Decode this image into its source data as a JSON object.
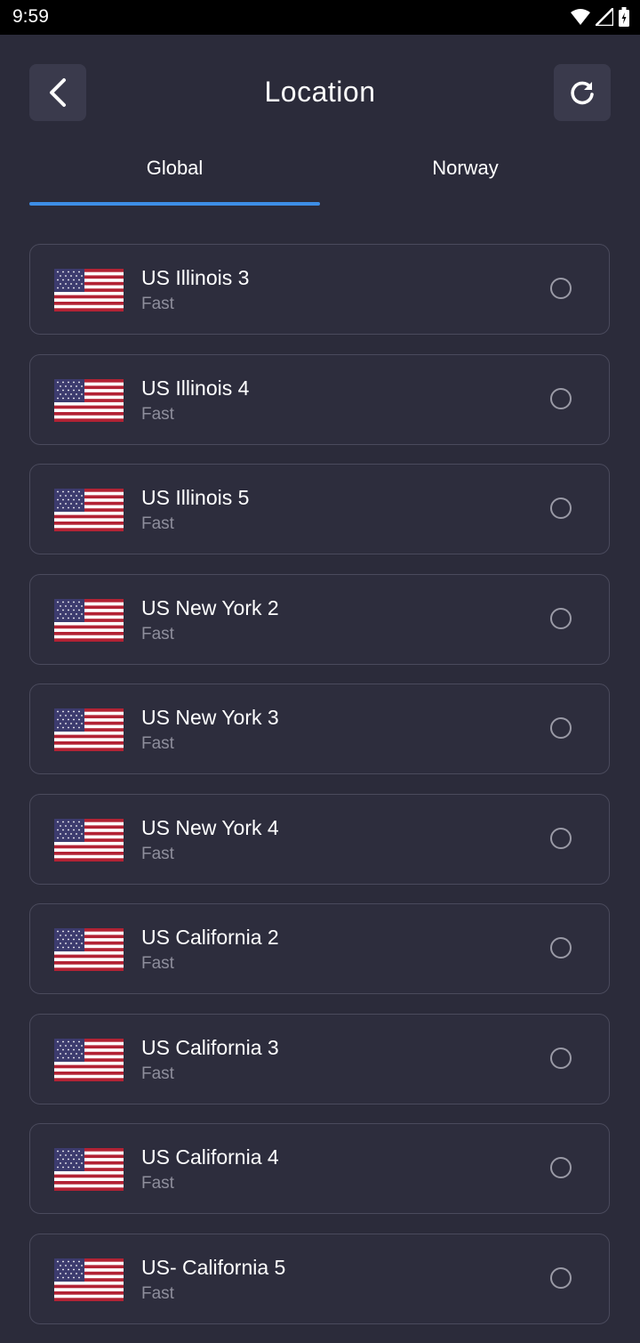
{
  "status_bar": {
    "time": "9:59"
  },
  "header": {
    "title": "Location"
  },
  "tabs": [
    {
      "label": "Global"
    },
    {
      "label": "Norway"
    }
  ],
  "colors": {
    "background": "#2b2b3a",
    "accent": "#3d8ee6",
    "card_border": "#4a4a5c",
    "subtext": "#8e8e9c"
  },
  "locations": [
    {
      "name": "US Illinois 3",
      "speed": "Fast",
      "flag": "us-flag-icon"
    },
    {
      "name": "US Illinois 4",
      "speed": "Fast",
      "flag": "us-flag-icon"
    },
    {
      "name": "US Illinois 5",
      "speed": "Fast",
      "flag": "us-flag-icon"
    },
    {
      "name": "US New York 2",
      "speed": "Fast",
      "flag": "us-flag-icon"
    },
    {
      "name": "US New York 3",
      "speed": "Fast",
      "flag": "us-flag-icon"
    },
    {
      "name": "US New York 4",
      "speed": "Fast",
      "flag": "us-flag-icon"
    },
    {
      "name": "US California 2",
      "speed": "Fast",
      "flag": "us-flag-icon"
    },
    {
      "name": "US California 3",
      "speed": "Fast",
      "flag": "us-flag-icon"
    },
    {
      "name": "US California 4",
      "speed": "Fast",
      "flag": "us-flag-icon"
    },
    {
      "name": "US- California 5",
      "speed": "Fast",
      "flag": "us-flag-icon"
    }
  ]
}
